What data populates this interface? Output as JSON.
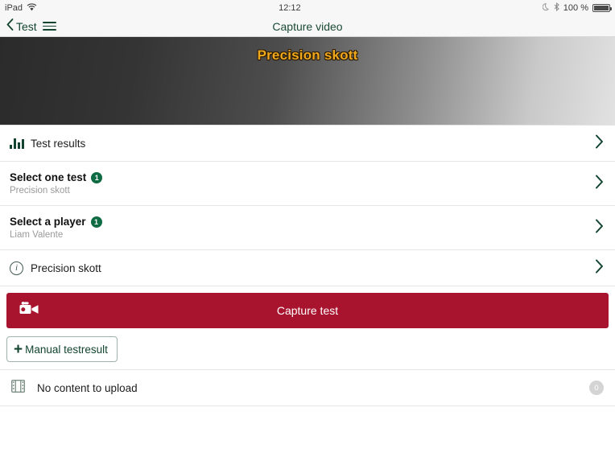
{
  "status_bar": {
    "device": "iPad",
    "wifi_icon": "wifi-icon",
    "time": "12:12",
    "moon_icon": "do-not-disturb-moon-icon",
    "bluetooth_icon": "bluetooth-icon",
    "battery_percent": "100 %",
    "battery_icon": "battery-full-icon"
  },
  "nav": {
    "back_icon": "chevron-left-icon",
    "back_label": "Test",
    "menu_icon": "hamburger-menu-icon",
    "title": "Capture video"
  },
  "hero": {
    "title": "Precision skott"
  },
  "rows": [
    {
      "name": "test-results",
      "icon": "bar-chart-icon",
      "title": "Test results",
      "badge": null,
      "subtitle": null,
      "chevron": "chevron-right-icon"
    },
    {
      "name": "select-one-test",
      "icon": null,
      "title": "Select one test",
      "badge": "1",
      "subtitle": "Precision skott",
      "chevron": "chevron-right-icon"
    },
    {
      "name": "select-a-player",
      "icon": null,
      "title": "Select a player",
      "badge": "1",
      "subtitle": "Liam Valente",
      "chevron": "chevron-right-icon"
    },
    {
      "name": "test-info",
      "icon": "info-circle-icon",
      "title": "Precision skott",
      "badge": null,
      "subtitle": null,
      "chevron": "chevron-right-icon"
    }
  ],
  "capture_button": {
    "icon": "video-camera-icon",
    "label": "Capture test",
    "color": "#a8132e"
  },
  "manual_button": {
    "icon": "plus-icon",
    "label": "Manual testresult"
  },
  "upload_row": {
    "icon": "film-strip-icon",
    "label": "No content to upload",
    "count": "0"
  },
  "colors": {
    "accent_green": "#12442f",
    "badge_green": "#0f6b44",
    "capture_red": "#a8132e",
    "hero_gold": "#f0a81e",
    "muted_gray": "#9a9a9a"
  }
}
